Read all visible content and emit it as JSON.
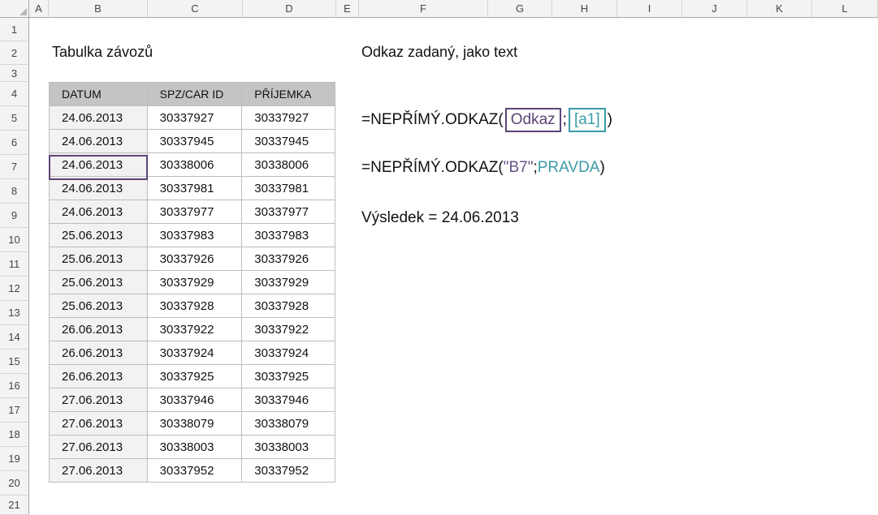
{
  "columns": [
    "A",
    "B",
    "C",
    "D",
    "E",
    "F",
    "G",
    "H",
    "I",
    "J",
    "K",
    "L"
  ],
  "rows": [
    "1",
    "2",
    "3",
    "4",
    "5",
    "6",
    "7",
    "8",
    "9",
    "10",
    "11",
    "12",
    "13",
    "14",
    "15",
    "16",
    "17",
    "18",
    "19",
    "20",
    "21"
  ],
  "table_title": "Tabulka závozů",
  "right_title": "Odkaz zadaný, jako text",
  "table": {
    "headers": [
      "DATUM",
      "SPZ/CAR ID",
      "PŘÍJEMKA"
    ],
    "rows": [
      [
        "24.06.2013",
        "30337927",
        "30337927"
      ],
      [
        "24.06.2013",
        "30337945",
        "30337945"
      ],
      [
        "24.06.2013",
        "30338006",
        "30338006"
      ],
      [
        "24.06.2013",
        "30337981",
        "30337981"
      ],
      [
        "24.06.2013",
        "30337977",
        "30337977"
      ],
      [
        "25.06.2013",
        "30337983",
        "30337983"
      ],
      [
        "25.06.2013",
        "30337926",
        "30337926"
      ],
      [
        "25.06.2013",
        "30337929",
        "30337929"
      ],
      [
        "25.06.2013",
        "30337928",
        "30337928"
      ],
      [
        "26.06.2013",
        "30337922",
        "30337922"
      ],
      [
        "26.06.2013",
        "30337924",
        "30337924"
      ],
      [
        "26.06.2013",
        "30337925",
        "30337925"
      ],
      [
        "27.06.2013",
        "30337946",
        "30337946"
      ],
      [
        "27.06.2013",
        "30338079",
        "30338079"
      ],
      [
        "27.06.2013",
        "30338003",
        "30338003"
      ],
      [
        "27.06.2013",
        "30337952",
        "30337952"
      ]
    ]
  },
  "syntax": {
    "prefix": "=NEPŘÍMÝ.ODKAZ(",
    "arg1": "Odkaz",
    "sep": ";",
    "arg2": "[a1]",
    "suffix": ")"
  },
  "example": {
    "prefix": "=NEPŘÍMÝ.ODKAZ(",
    "arg1": "\"B7\"",
    "sep": ";",
    "arg2": "PRAVDA",
    "suffix": ")"
  },
  "result": "Výsledek = 24.06.2013",
  "colors": {
    "accent_purple": "#5b4477",
    "accent_teal": "#3b9ba7"
  }
}
